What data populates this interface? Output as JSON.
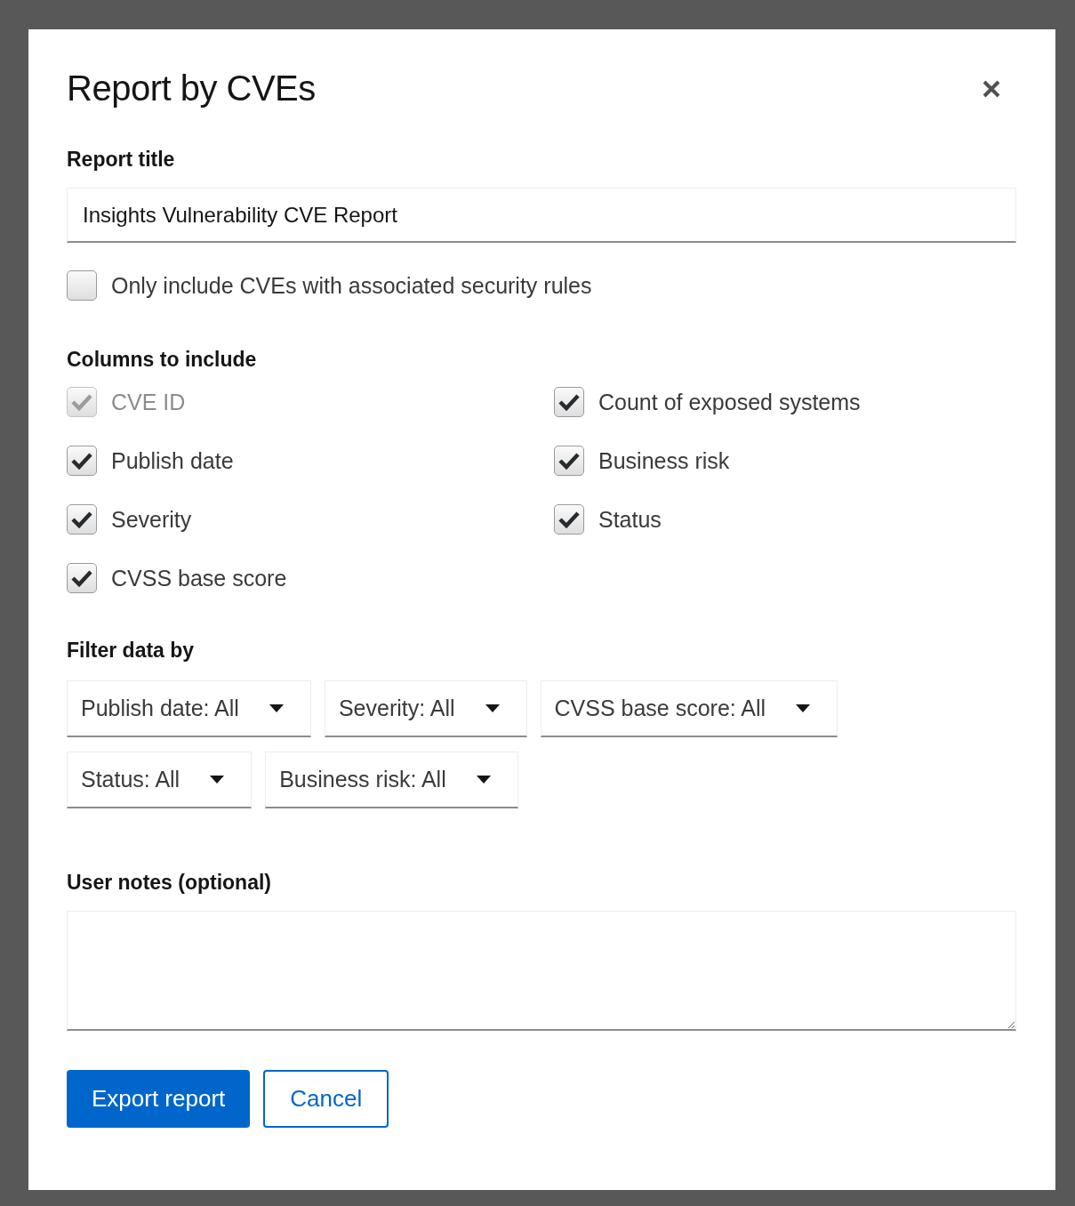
{
  "dialog": {
    "title": "Report by CVEs"
  },
  "report_title": {
    "label": "Report title",
    "value": "Insights Vulnerability CVE Report"
  },
  "rules_only": {
    "label": "Only include CVEs with associated security rules",
    "checked": false
  },
  "columns": {
    "label": "Columns to include",
    "items": [
      {
        "label": "CVE ID",
        "checked": true,
        "disabled": true
      },
      {
        "label": "Publish date",
        "checked": true,
        "disabled": false
      },
      {
        "label": "Severity",
        "checked": true,
        "disabled": false
      },
      {
        "label": "CVSS base score",
        "checked": true,
        "disabled": false
      },
      {
        "label": "Count of exposed systems",
        "checked": true,
        "disabled": false
      },
      {
        "label": "Business risk",
        "checked": true,
        "disabled": false
      },
      {
        "label": "Status",
        "checked": true,
        "disabled": false
      }
    ]
  },
  "filters": {
    "label": "Filter data by",
    "rows": [
      [
        "Publish date: All",
        "Severity: All",
        "CVSS base score: All"
      ],
      [
        "Status: All",
        "Business risk: All"
      ]
    ]
  },
  "notes": {
    "label": "User notes (optional)"
  },
  "buttons": [
    {
      "label": "Export report",
      "kind": "primary"
    },
    {
      "label": "Cancel",
      "kind": "secondary"
    }
  ]
}
